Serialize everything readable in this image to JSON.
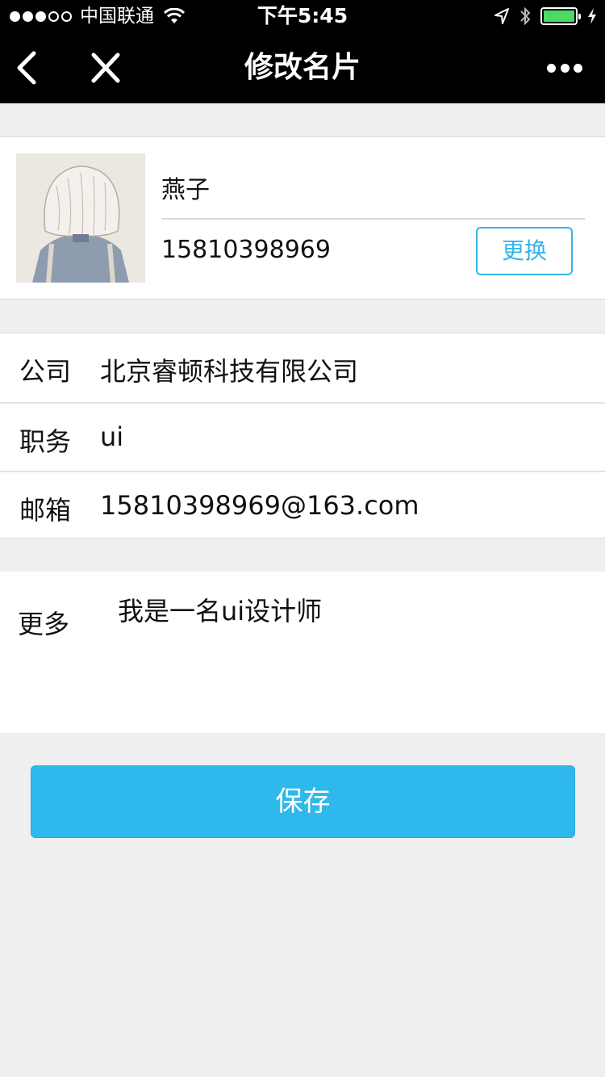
{
  "status_bar": {
    "carrier": "中国联通",
    "time": "下午5:45",
    "signal_filled": 3,
    "signal_total": 5,
    "battery_color": "#4cd964"
  },
  "nav": {
    "title": "修改名片",
    "back_icon": "chevron-left-icon",
    "close_icon": "close-icon",
    "more_icon": "more-horizontal-icon"
  },
  "profile": {
    "name": "燕子",
    "phone": "15810398969",
    "change_label": "更换"
  },
  "info": {
    "rows": [
      {
        "label": "公司",
        "value": "北京睿顿科技有限公司"
      },
      {
        "label": "职务",
        "value": "ui"
      },
      {
        "label": "邮箱",
        "value": "15810398969@163.com"
      }
    ]
  },
  "more": {
    "label": "更多",
    "value": "我是一名ui设计师"
  },
  "save_label": "保存",
  "colors": {
    "accent": "#2fb8ec",
    "background": "#efefef",
    "navbar": "#000000"
  }
}
